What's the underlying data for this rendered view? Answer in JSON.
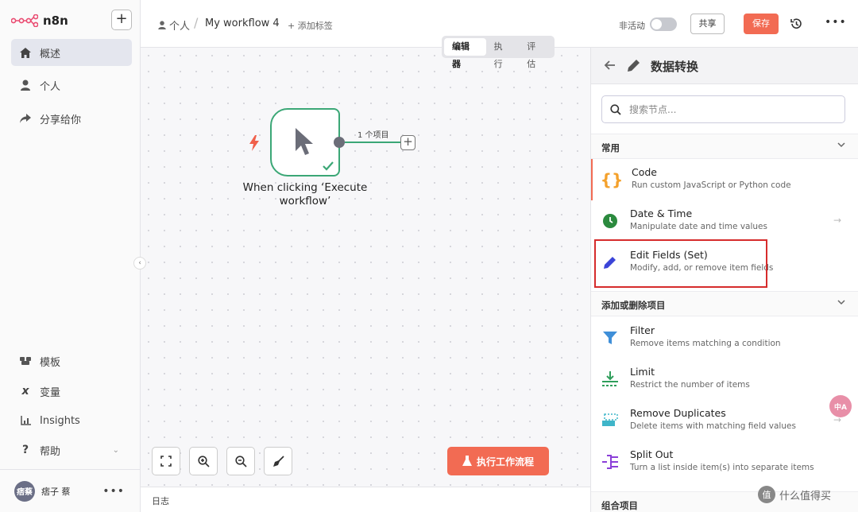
{
  "app": {
    "name": "n8n",
    "brand_color": "#f26b53",
    "success_color": "#3ba776"
  },
  "sidebar": {
    "items": [
      {
        "label": "概述",
        "icon": "home-icon",
        "active": true
      },
      {
        "label": "个人",
        "icon": "user-icon"
      },
      {
        "label": "分享给你",
        "icon": "share-icon"
      }
    ],
    "bottom_items": [
      {
        "label": "模板",
        "icon": "template-icon"
      },
      {
        "label": "变量",
        "icon": "variable-icon"
      },
      {
        "label": "Insights",
        "icon": "insights-icon"
      },
      {
        "label": "帮助",
        "icon": "help-icon"
      }
    ],
    "user": {
      "avatar_text": "痞蔡",
      "name": "痞子 蔡"
    }
  },
  "header": {
    "breadcrumb_owner": "个人",
    "separator": "/",
    "workflow_name": "My workflow 4",
    "add_tag": "+ 添加标签",
    "inactive_label": "非活动",
    "share_label": "共享",
    "save_label": "保存"
  },
  "tabs": [
    {
      "label": "编辑器",
      "active": true
    },
    {
      "label": "执行"
    },
    {
      "label": "评估"
    }
  ],
  "canvas": {
    "node_title": "When clicking ‘Execute workflow’",
    "items_label": "1 个项目",
    "execute_label": "执行工作流程",
    "log_label": "日志"
  },
  "panel": {
    "title": "数据转换",
    "search_placeholder": "搜索节点...",
    "sections": [
      {
        "label": "常用",
        "items": [
          {
            "name": "Code",
            "desc": "Run custom JavaScript or Python code",
            "icon": "code-braces-icon"
          },
          {
            "name": "Date & Time",
            "desc": "Manipulate date and time values",
            "icon": "clock-icon"
          },
          {
            "name": "Edit Fields (Set)",
            "desc": "Modify, add, or remove item fields",
            "icon": "pencil-icon"
          }
        ]
      },
      {
        "label": "添加或删除项目",
        "items": [
          {
            "name": "Filter",
            "desc": "Remove items matching a condition",
            "icon": "filter-icon"
          },
          {
            "name": "Limit",
            "desc": "Restrict the number of items",
            "icon": "limit-icon"
          },
          {
            "name": "Remove Duplicates",
            "desc": "Delete items with matching field values",
            "icon": "duplicates-icon"
          },
          {
            "name": "Split Out",
            "desc": "Turn a list inside item(s) into separate items",
            "icon": "split-icon"
          }
        ]
      },
      {
        "label": "组合项目"
      }
    ]
  },
  "overlay": {
    "translate_badge": "中A",
    "watermark": "什么值得买",
    "watermark_logo": "值"
  }
}
